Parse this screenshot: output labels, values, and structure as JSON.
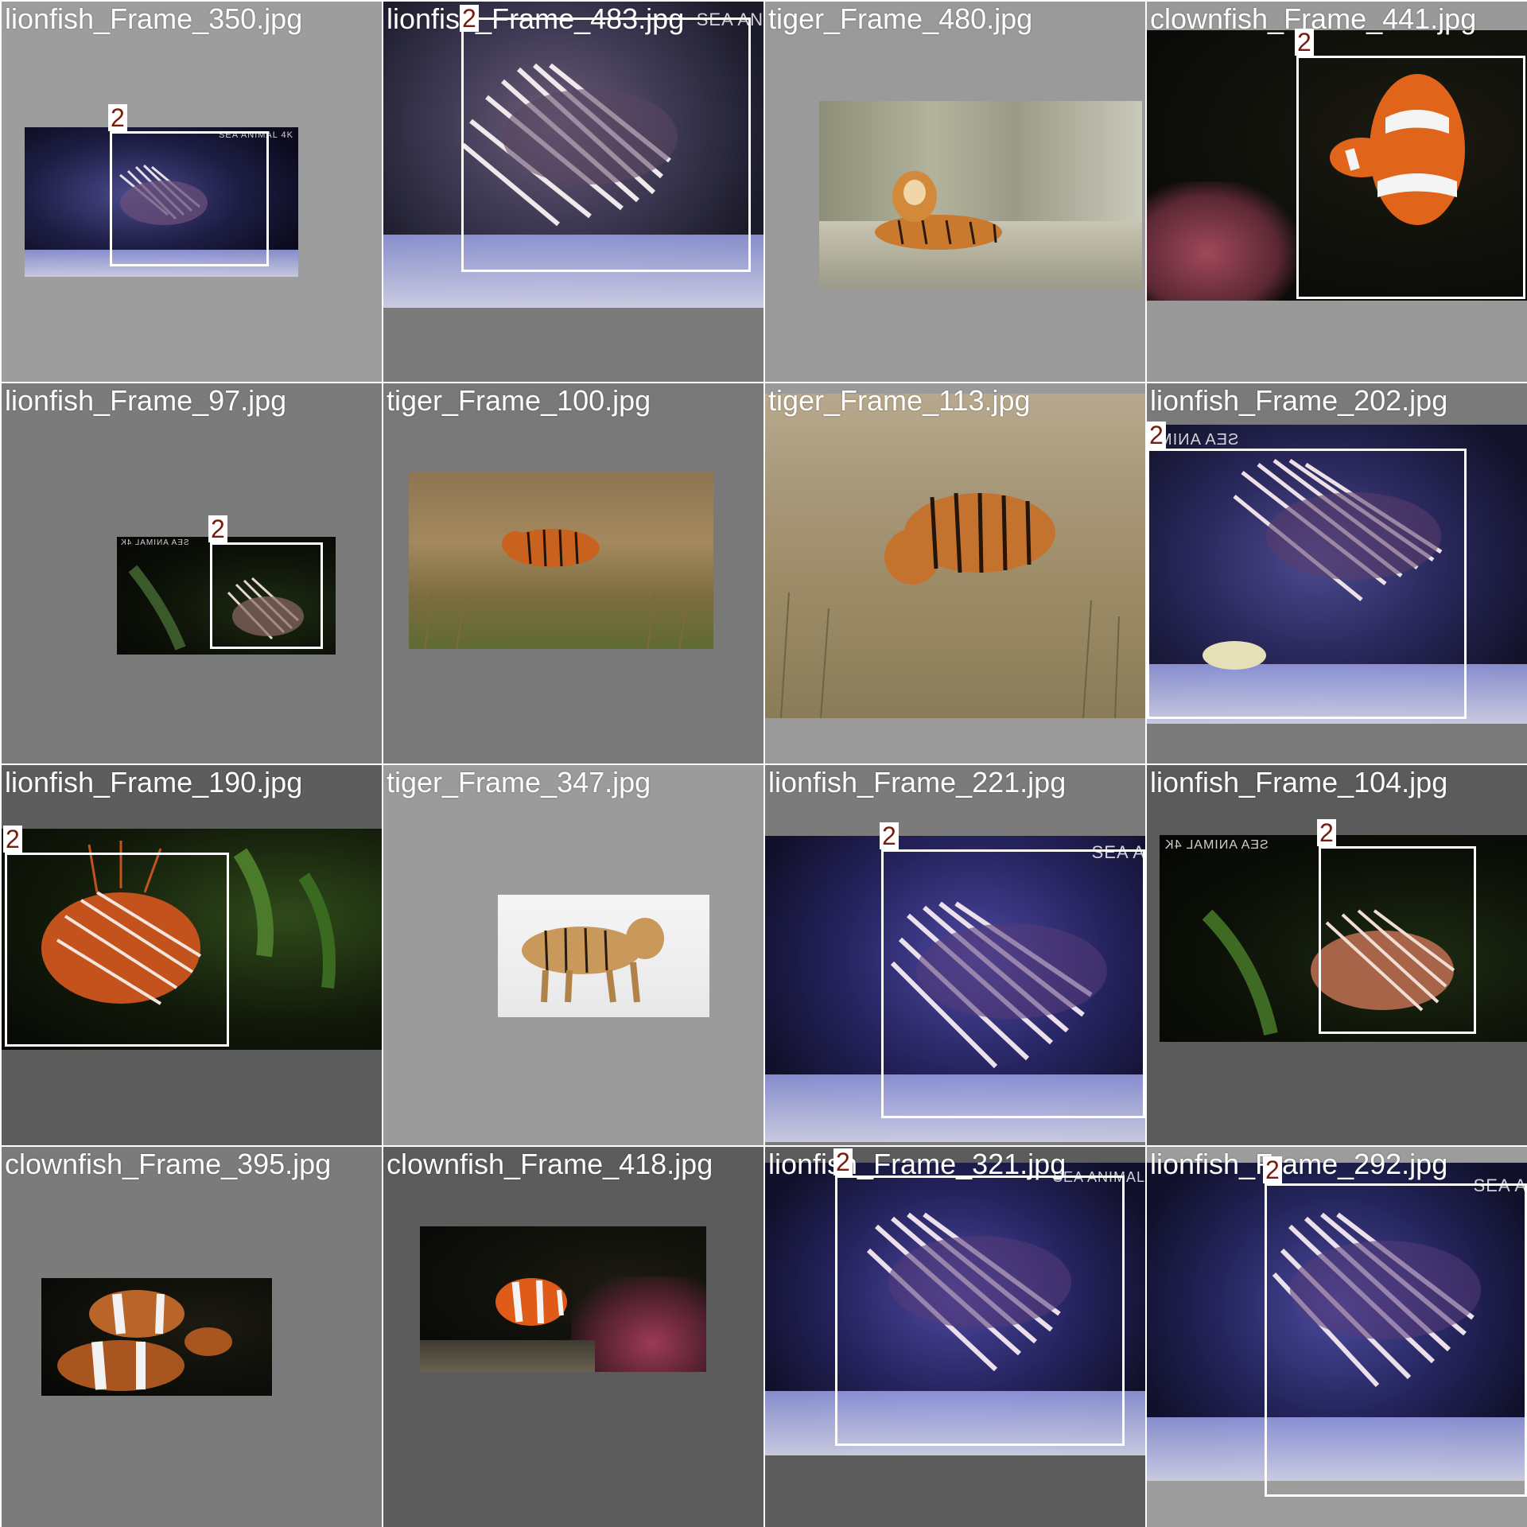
{
  "mosaic": {
    "box_class_label": "2",
    "tiles": [
      {
        "filename": "lionfish_Frame_350.jpg",
        "subject": "lionfish",
        "watermark": "SEA ANIMAL 4K"
      },
      {
        "filename": "lionfish_Frame_483.jpg",
        "subject": "lionfish",
        "watermark": "SEA AN"
      },
      {
        "filename": "tiger_Frame_480.jpg",
        "subject": "tiger",
        "watermark": ""
      },
      {
        "filename": "clownfish_Frame_441.jpg",
        "subject": "clownfish",
        "watermark": ""
      },
      {
        "filename": "lionfish_Frame_97.jpg",
        "subject": "lionfish",
        "watermark": "SEA ANIMAL 4K"
      },
      {
        "filename": "tiger_Frame_100.jpg",
        "subject": "tiger",
        "watermark": ""
      },
      {
        "filename": "tiger_Frame_113.jpg",
        "subject": "tiger",
        "watermark": ""
      },
      {
        "filename": "lionfish_Frame_202.jpg",
        "subject": "lionfish",
        "watermark": "SEA ANIM"
      },
      {
        "filename": "lionfish_Frame_190.jpg",
        "subject": "lionfish",
        "watermark": ""
      },
      {
        "filename": "tiger_Frame_347.jpg",
        "subject": "tiger",
        "watermark": ""
      },
      {
        "filename": "lionfish_Frame_221.jpg",
        "subject": "lionfish",
        "watermark": "SEA A"
      },
      {
        "filename": "lionfish_Frame_104.jpg",
        "subject": "lionfish",
        "watermark": "SEA ANIMAL 4K"
      },
      {
        "filename": "clownfish_Frame_395.jpg",
        "subject": "clownfish",
        "watermark": ""
      },
      {
        "filename": "clownfish_Frame_418.jpg",
        "subject": "clownfish",
        "watermark": ""
      },
      {
        "filename": "lionfish_Frame_321.jpg",
        "subject": "lionfish",
        "watermark": "SEA ANIMAL"
      },
      {
        "filename": "lionfish_Frame_292.jpg",
        "subject": "lionfish",
        "watermark": "SEA A"
      }
    ]
  },
  "colors": {
    "tile_gray_light": "#9a9a9a",
    "tile_gray_mid": "#7a7a7a",
    "tile_gray_dark": "#5a5a5a",
    "box": "#ffffff",
    "box_label_text": "#7a1a0c"
  }
}
